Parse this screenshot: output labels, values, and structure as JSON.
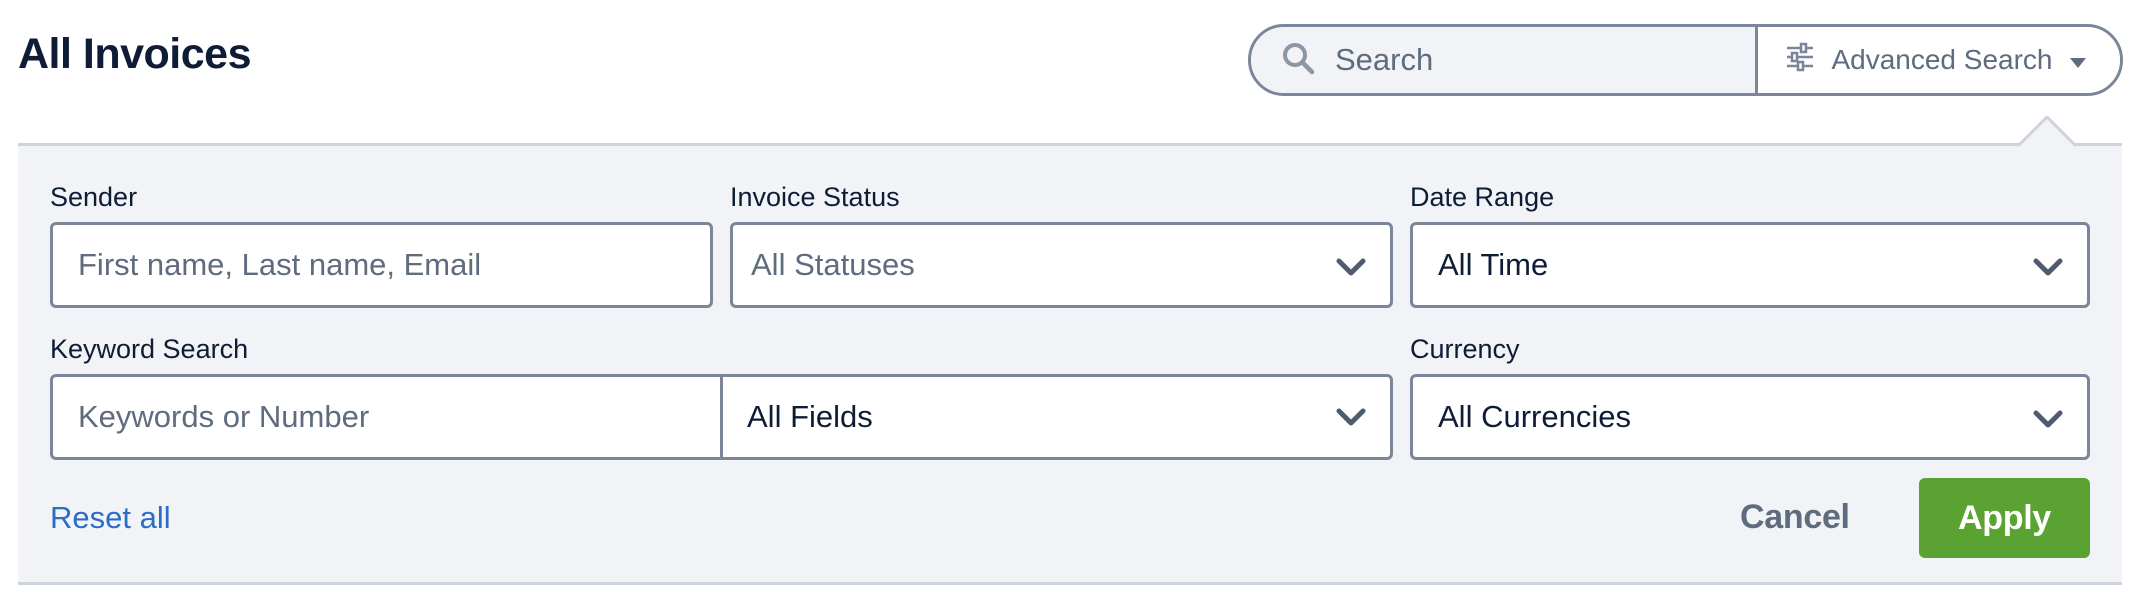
{
  "header": {
    "title": "All Invoices"
  },
  "search": {
    "placeholder": "Search",
    "advanced_label": "Advanced Search"
  },
  "filters": {
    "sender": {
      "label": "Sender",
      "placeholder": "First name, Last name, Email"
    },
    "invoice_status": {
      "label": "Invoice Status",
      "selected": "All Statuses"
    },
    "date_range": {
      "label": "Date Range",
      "selected": "All Time"
    },
    "keyword": {
      "label": "Keyword Search",
      "placeholder": "Keywords or Number",
      "field_selected": "All Fields"
    },
    "currency": {
      "label": "Currency",
      "selected": "All Currencies"
    }
  },
  "actions": {
    "reset_label": "Reset all",
    "cancel_label": "Cancel",
    "apply_label": "Apply"
  },
  "icons": {
    "search": "search-icon",
    "advanced": "sliders-icon",
    "dropdown": "caret-down-icon",
    "select": "chevron-down-icon"
  },
  "colors": {
    "title": "#0e1c36",
    "border": "#7b8699",
    "panel_bg": "#f1f3f6",
    "link": "#2a6dc5",
    "apply_bg": "#5aa332"
  }
}
